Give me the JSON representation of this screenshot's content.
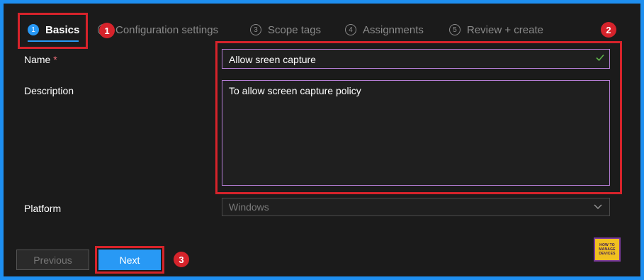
{
  "wizard": {
    "steps": [
      {
        "num": "1",
        "label": "Basics"
      },
      {
        "num": "2",
        "label": "Configuration settings"
      },
      {
        "num": "3",
        "label": "Scope tags"
      },
      {
        "num": "4",
        "label": "Assignments"
      },
      {
        "num": "5",
        "label": "Review + create"
      }
    ],
    "active_step": 1
  },
  "form": {
    "name_label": "Name",
    "required_mark": "*",
    "name_value": "Allow sreen capture",
    "description_label": "Description",
    "description_value": "To allow screen capture policy",
    "platform_label": "Platform",
    "platform_value": "Windows"
  },
  "buttons": {
    "previous": "Previous",
    "next": "Next"
  },
  "annotations": {
    "badge_1": "1",
    "badge_2": "2",
    "badge_3": "3"
  },
  "logo": {
    "line1": "HOW TO",
    "line2": "MANAGE",
    "line3": "DEVICES"
  },
  "colors": {
    "accent": "#2899f5",
    "frame": "#1e8ff0",
    "highlight": "#d6232b",
    "background": "#1b1b1b",
    "input_border": "#b67ed6",
    "valid_check": "#5fb24a"
  },
  "icons": {
    "valid": "check-icon",
    "dropdown": "chevron-down-icon"
  }
}
